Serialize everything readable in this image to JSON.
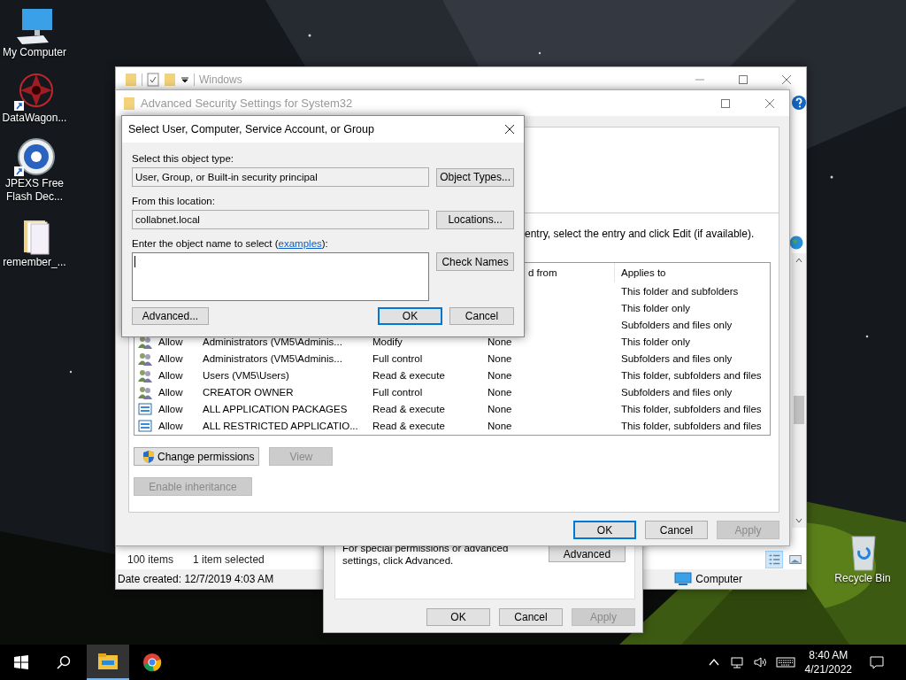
{
  "desktop_icons": [
    {
      "label": "My Computer",
      "kind": "computer",
      "shortcut": false
    },
    {
      "label": "DataWagon...",
      "kind": "star",
      "shortcut": true
    },
    {
      "label": "JPEXS Free Flash Dec...",
      "kind": "ffdec",
      "shortcut": true
    },
    {
      "label": "remember_...",
      "kind": "folder",
      "shortcut": false
    },
    {
      "label": "Recycle Bin",
      "kind": "recycle",
      "shortcut": false
    }
  ],
  "explorer": {
    "title": "Windows",
    "item_count": "100 items",
    "selection": "1 item selected",
    "details": "Date created: 12/7/2019 4:03 AM",
    "location": "Computer",
    "view_buttons": [
      {
        "kind": "details",
        "selected": true
      },
      {
        "kind": "preview",
        "selected": false
      }
    ]
  },
  "properties": {
    "note": "For special permissions or advanced settings, click Advanced.",
    "advanced_button": "Advanced",
    "buttons": [
      {
        "label": "OK",
        "disabled": false
      },
      {
        "label": "Cancel",
        "disabled": false
      },
      {
        "label": "Apply",
        "disabled": true
      }
    ]
  },
  "advanced": {
    "title": "Advanced Security Settings for System32",
    "instruction": "entry, select the entry and click Edit (if available).",
    "columns": [
      {
        "kind": "inherited",
        "label": "d from"
      },
      {
        "kind": "applies",
        "label": "Applies to"
      }
    ],
    "rows": [
      {
        "applies_to": "This folder and subfolders"
      },
      {
        "applies_to": "This folder only"
      },
      {
        "applies_to": "Subfolders and files only"
      },
      {
        "kind": "user",
        "type": "Allow",
        "principal": "Administrators (VM5\\Adminis...",
        "access": "Modify",
        "inherited_from": "None",
        "applies_to": "This folder only"
      },
      {
        "kind": "user",
        "type": "Allow",
        "principal": "Administrators (VM5\\Adminis...",
        "access": "Full control",
        "inherited_from": "None",
        "applies_to": "Subfolders and files only"
      },
      {
        "kind": "user",
        "type": "Allow",
        "principal": "Users (VM5\\Users)",
        "access": "Read & execute",
        "inherited_from": "None",
        "applies_to": "This folder, subfolders and files"
      },
      {
        "kind": "user",
        "type": "Allow",
        "principal": "CREATOR OWNER",
        "access": "Full control",
        "inherited_from": "None",
        "applies_to": "Subfolders and files only"
      },
      {
        "kind": "package",
        "type": "Allow",
        "principal": "ALL APPLICATION PACKAGES",
        "access": "Read & execute",
        "inherited_from": "None",
        "applies_to": "This folder, subfolders and files"
      },
      {
        "kind": "package",
        "type": "Allow",
        "principal": "ALL RESTRICTED APPLICATIO...",
        "access": "Read & execute",
        "inherited_from": "None",
        "applies_to": "This folder, subfolders and files"
      }
    ],
    "change_permissions": "Change permissions",
    "view_button": {
      "label": "View",
      "disabled": true
    },
    "inheritance_button": {
      "label": "Enable inheritance",
      "disabled": true
    },
    "buttons": [
      {
        "label": "OK",
        "disabled": false,
        "default": true
      },
      {
        "label": "Cancel",
        "disabled": false,
        "default": false
      },
      {
        "label": "Apply",
        "disabled": true,
        "default": false
      }
    ]
  },
  "dialog": {
    "title": "Select User, Computer, Service Account, or Group",
    "object_type_label": "Select this object type:",
    "object_type": "User, Group, or Built-in security principal",
    "object_types_button": "Object Types...",
    "location_label": "From this location:",
    "location": "collabnet.local",
    "locations_button": "Locations...",
    "name_label_before": "Enter the object name to select (",
    "name_label_link": "examples",
    "name_label_after": "):",
    "check_names_button": "Check Names",
    "advanced_button": "Advanced...",
    "ok_button": "OK",
    "cancel_button": "Cancel"
  },
  "taskbar": {
    "apps": [
      {
        "kind": "explorer",
        "active": true
      },
      {
        "kind": "chrome",
        "active": false
      }
    ],
    "time": "8:40 AM",
    "date": "4/21/2022"
  }
}
